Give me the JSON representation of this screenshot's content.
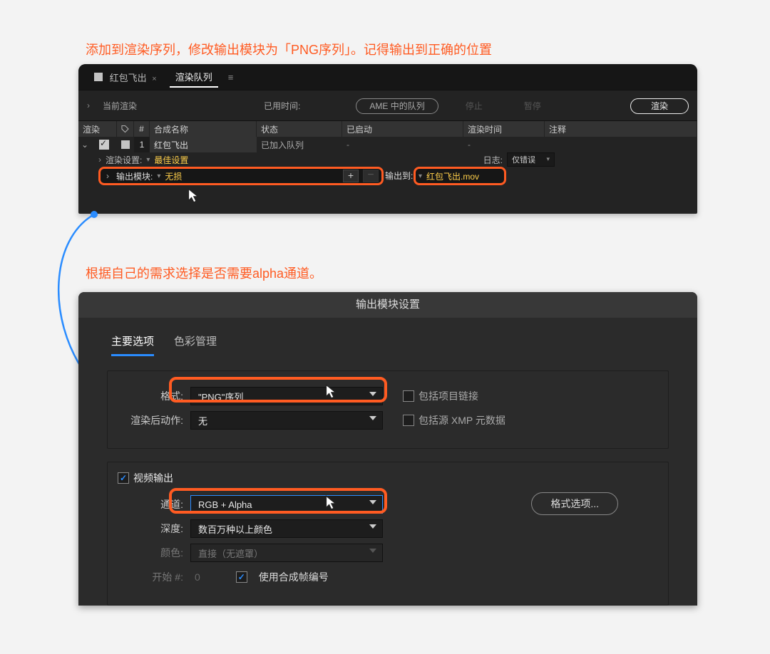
{
  "caption1": "添加到渲染序列，修改输出模块为「PNG序列」。记得输出到正确的位置",
  "caption2": "根据自己的需求选择是否需要alpha通道。",
  "panel1": {
    "tabs": {
      "comp": "红包飞出",
      "queue": "渲染队列"
    },
    "toolbar": {
      "current": "当前渲染",
      "elapsed_label": "已用时间:",
      "ame": "AME 中的队列",
      "stop": "停止",
      "pause": "暂停",
      "render": "渲染"
    },
    "columns": {
      "render": "渲染",
      "tag": "",
      "num": "#",
      "comp": "合成名称",
      "status": "状态",
      "start": "已启动",
      "rtime": "渲染时间",
      "note": "注释"
    },
    "item": {
      "num": "1",
      "comp": "红包飞出",
      "status": "已加入队列"
    },
    "sub1": {
      "rs_label": "渲染设置:",
      "rs_value": "最佳设置",
      "log_label": "日志:",
      "log_value": "仅错误"
    },
    "sub2": {
      "om_label": "输出模块:",
      "om_value": "无损",
      "out_label": "输出到:",
      "out_value": "红包飞出.mov"
    }
  },
  "panel2": {
    "title": "输出模块设置",
    "tabs": {
      "main": "主要选项",
      "color": "色彩管理"
    },
    "row_format": {
      "label": "格式:",
      "value": "\"PNG\"序列"
    },
    "row_post": {
      "label": "渲染后动作:",
      "value": "无"
    },
    "opt_link": "包括项目链接",
    "opt_xmp": "包括源 XMP 元数据",
    "video_out": "视频输出",
    "row_channel": {
      "label": "通道:",
      "value": "RGB + Alpha"
    },
    "row_depth": {
      "label": "深度:",
      "value": "数百万种以上颜色"
    },
    "row_color": {
      "label": "颜色:",
      "value": "直接（无遮罩）"
    },
    "row_start": {
      "label": "开始 #:",
      "value": "0",
      "use_comp": "使用合成帧编号"
    },
    "format_options": "格式选项..."
  }
}
